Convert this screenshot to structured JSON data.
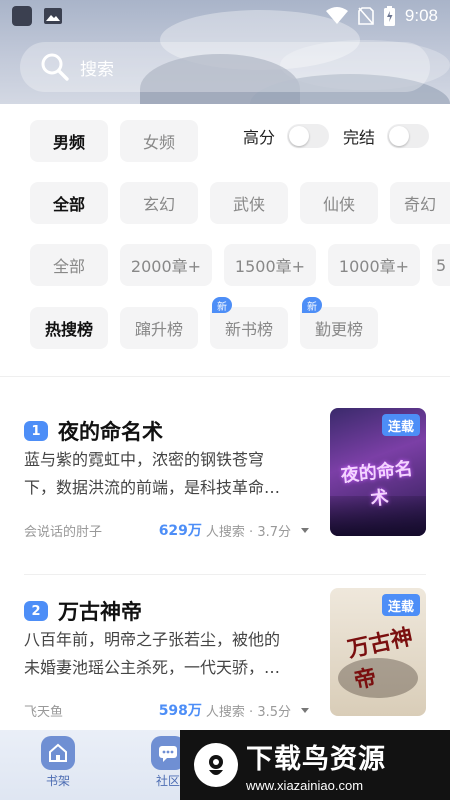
{
  "status_bar": {
    "time": "9:08"
  },
  "search": {
    "placeholder": "搜索"
  },
  "filters": {
    "gender_tabs": [
      {
        "label": "男频",
        "active": true
      },
      {
        "label": "女频",
        "active": false
      }
    ],
    "toggles": [
      {
        "label": "高分",
        "on": false
      },
      {
        "label": "完结",
        "on": false
      }
    ],
    "genres": [
      "全部",
      "玄幻",
      "武侠",
      "仙侠",
      "奇幻"
    ],
    "chapters": [
      "全部",
      "2000章+",
      "1500章+",
      "1000章+",
      "5"
    ],
    "rankings": [
      {
        "label": "热搜榜",
        "active": true,
        "badge": ""
      },
      {
        "label": "蹿升榜",
        "active": false,
        "badge": ""
      },
      {
        "label": "新书榜",
        "active": false,
        "badge": "新"
      },
      {
        "label": "勤更榜",
        "active": false,
        "badge": "新"
      }
    ]
  },
  "books": [
    {
      "rank": "1",
      "title": "夜的命名术",
      "desc_line1": "蓝与紫的霓虹中，浓密的钢铁苍穹",
      "desc_line2": "下，数据洪流的前端，是科技革命…",
      "author": "会说话的肘子",
      "search_count": "629万",
      "search_suffix": "人搜索 · 3.7分",
      "status_tag": "连载",
      "cover_text": "夜的命名术"
    },
    {
      "rank": "2",
      "title": "万古神帝",
      "desc_line1": "八百年前，明帝之子张若尘，被他的",
      "desc_line2": "未婚妻池瑶公主杀死，一代天骄，…",
      "author": "飞天鱼",
      "search_count": "598万",
      "search_suffix": "人搜索 · 3.5分",
      "status_tag": "连载",
      "cover_text": "万古神帝"
    }
  ],
  "bottom_nav": [
    {
      "label": "书架",
      "icon": "home-icon"
    },
    {
      "label": "社区",
      "icon": "chat-icon"
    }
  ],
  "watermark": {
    "title": "下载鸟资源",
    "url": "www.xiazainiao.com"
  },
  "colors": {
    "accent": "#4d8ef7",
    "chip_bg": "#f4f4f5"
  }
}
